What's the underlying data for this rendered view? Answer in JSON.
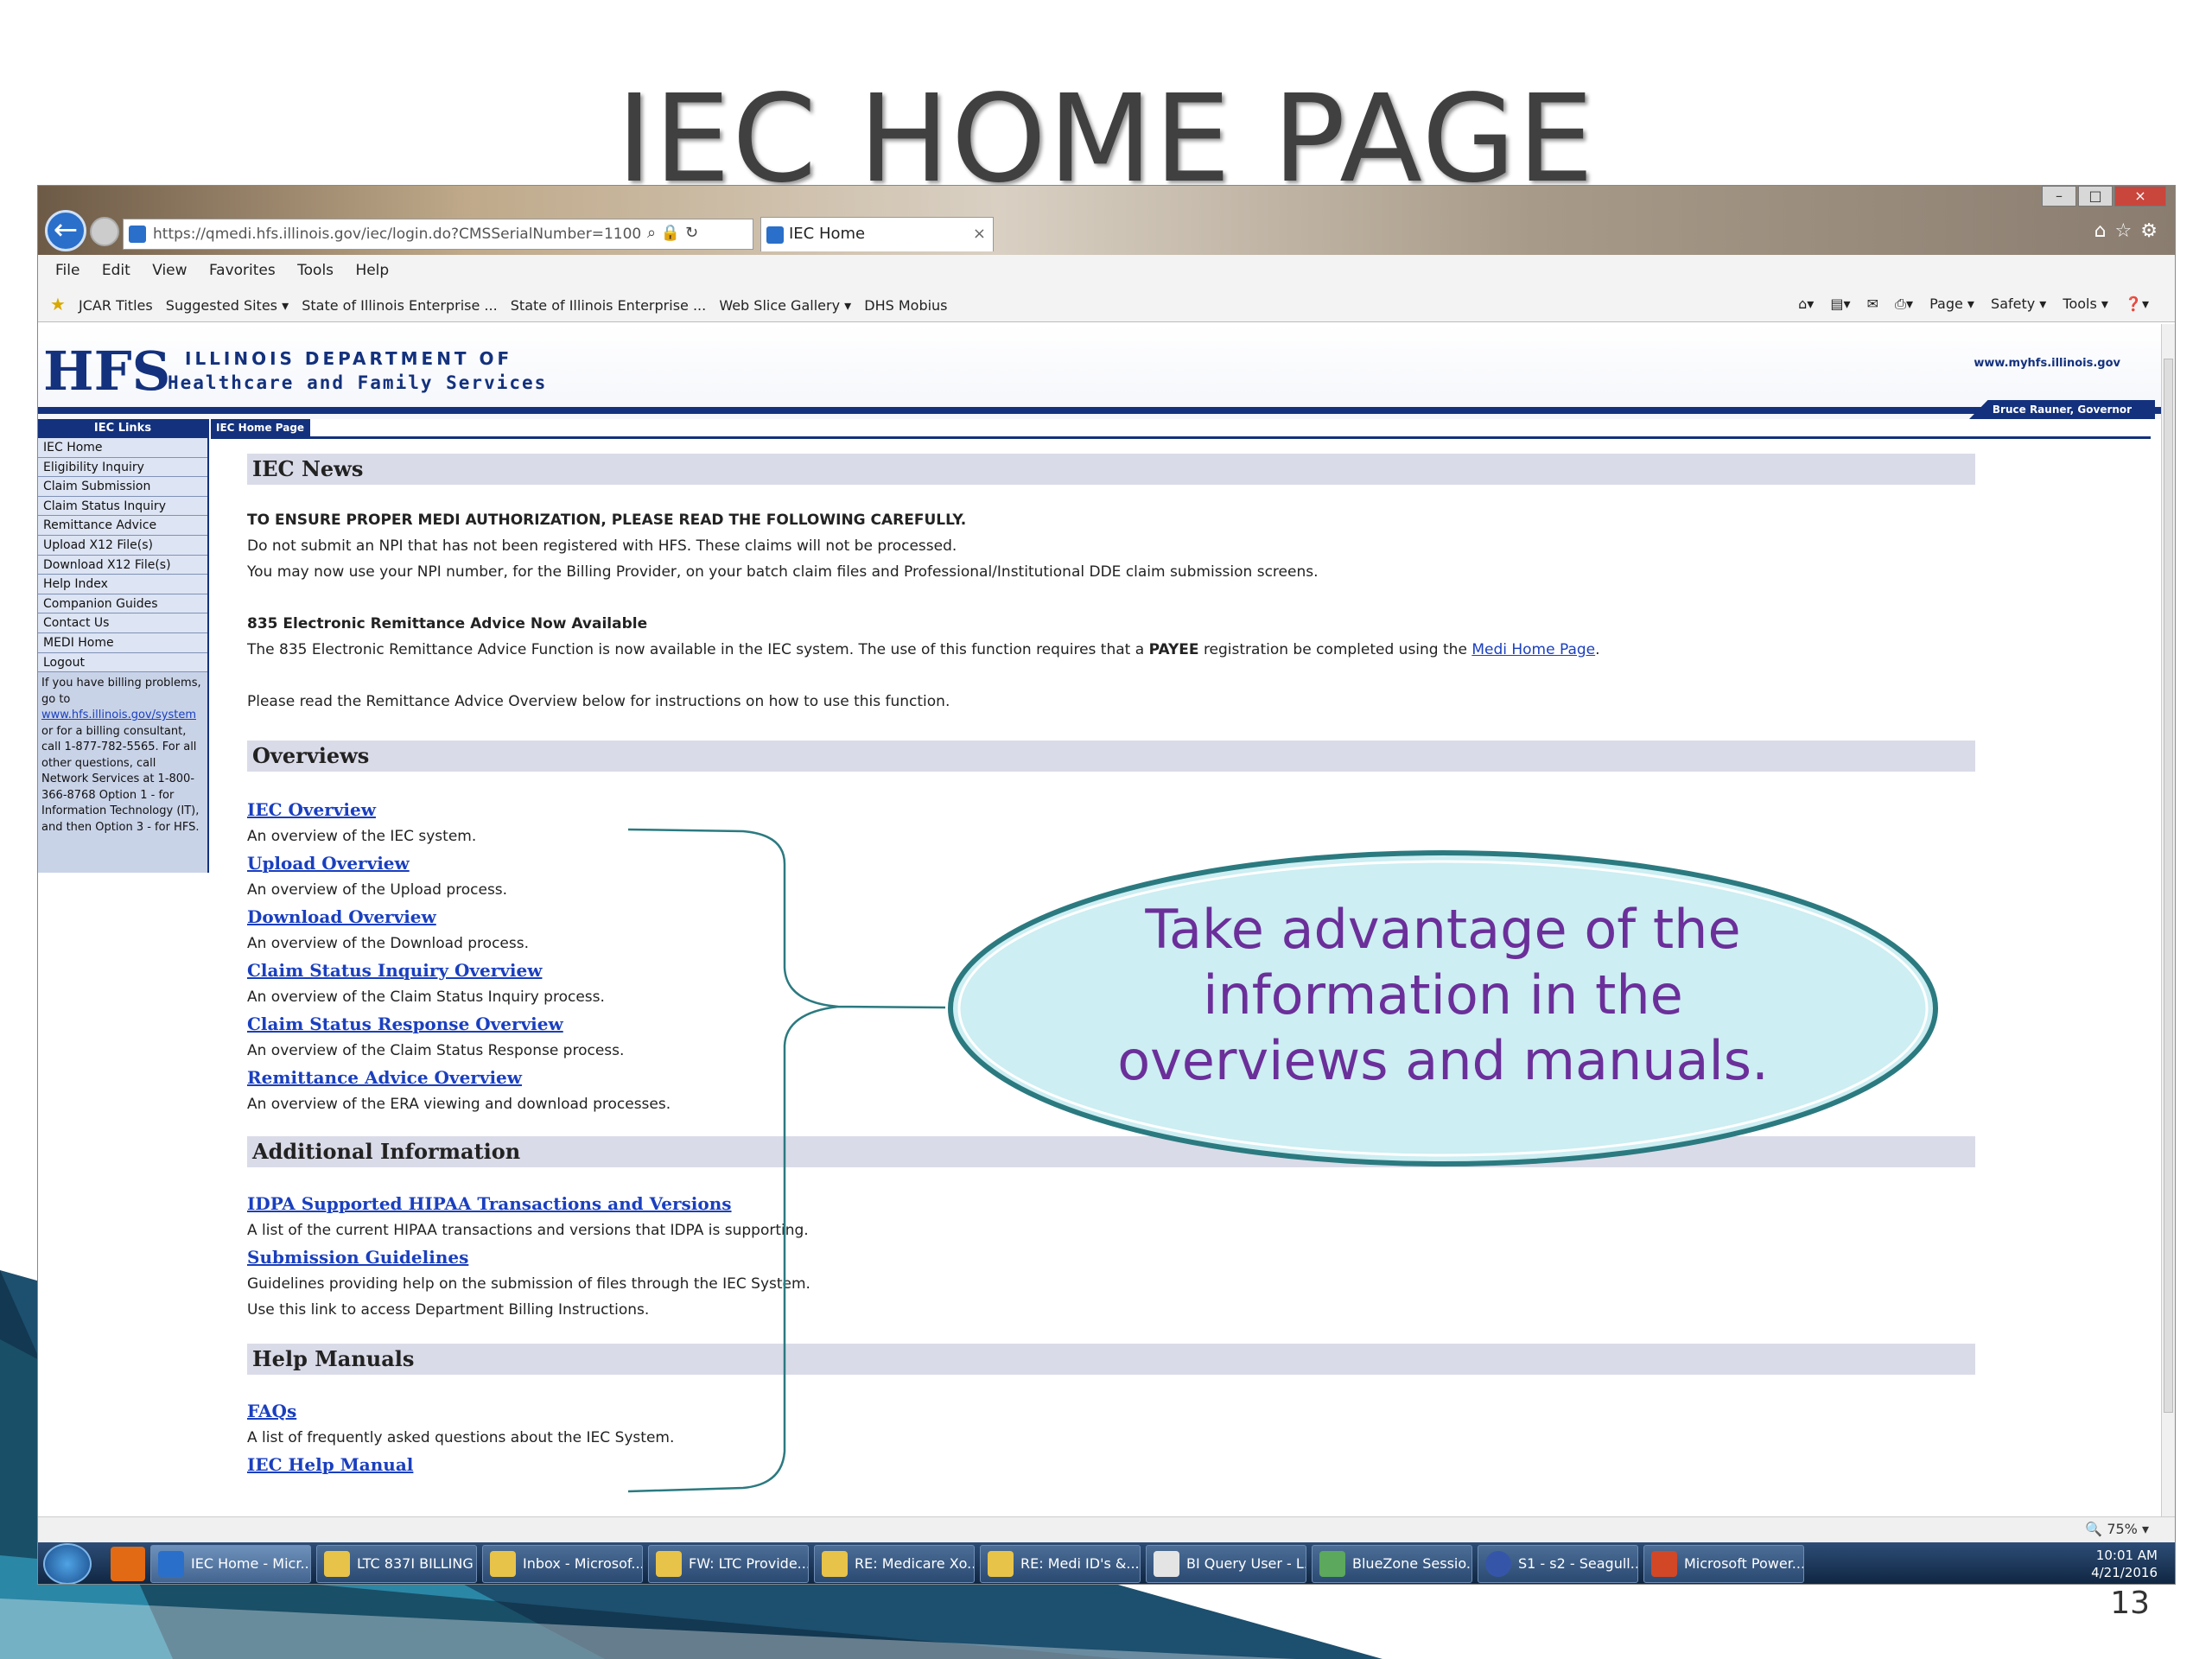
{
  "slide": {
    "title": "IEC HOME PAGE",
    "number": "13"
  },
  "browser": {
    "url": "https://qmedi.hfs.illinois.gov/iec/login.do?CMSSerialNumber=1100",
    "tab_title": "IEC Home",
    "menu": [
      "File",
      "Edit",
      "View",
      "Favorites",
      "Tools",
      "Help"
    ],
    "favorites": [
      "JCAR Titles",
      "Suggested Sites ▾",
      "State of Illinois Enterprise ...",
      "State of Illinois Enterprise ...",
      "Web Slice Gallery ▾",
      "DHS Mobius"
    ],
    "commands": [
      "Page ▾",
      "Safety ▾",
      "Tools ▾"
    ],
    "zoom": "75%"
  },
  "header": {
    "logo": "HFS",
    "dept_line1": "ILLINOIS DEPARTMENT OF",
    "dept_line2": "Healthcare and Family Services",
    "site_url": "www.myhfs.illinois.gov",
    "governor": "Bruce Rauner, Governor"
  },
  "sidebar": {
    "heading": "IEC Links",
    "items": [
      {
        "label": "IEC Home"
      },
      {
        "label": "Eligibility Inquiry"
      },
      {
        "label": "Claim Submission"
      },
      {
        "label": "Claim Status Inquiry"
      },
      {
        "label": "Remittance Advice"
      },
      {
        "label": "Upload X12 File(s)"
      },
      {
        "label": "Download X12 File(s)"
      },
      {
        "label": "Help Index"
      },
      {
        "label": "Companion Guides"
      },
      {
        "label": "Contact Us"
      },
      {
        "label": "MEDI Home"
      },
      {
        "label": "Logout"
      }
    ],
    "note_pre": "If you have billing problems, go to",
    "note_link": "www.hfs.illinois.gov/system",
    "note_post": "or for a billing consultant, call 1-877-782-5565. For all other questions, call Network Services at 1-800-366-8768 Option 1 - for Information Technology (IT), and then Option 3 - for HFS."
  },
  "page_tab": "IEC Home Page",
  "news": {
    "heading": "IEC News",
    "alert": "TO ENSURE PROPER MEDI AUTHORIZATION, PLEASE READ THE FOLLOWING CAREFULLY.",
    "line1": "Do not submit an NPI that has not been registered with HFS. These claims will not be processed.",
    "line2": "You may now use your NPI number, for the Billing Provider, on your batch claim files and Professional/Institutional DDE claim submission screens.",
    "era_title": "835 Electronic Remittance Advice Now Available",
    "era_text_pre": "The 835 Electronic Remittance Advice Function is now available in the IEC system. The use of this function requires that a",
    "era_bold": "PAYEE",
    "era_text_mid": "registration be completed using the",
    "era_link": "Medi Home Page",
    "era_text_end": ".",
    "read_note": "Please read the Remittance Advice Overview below for instructions on how to use this function."
  },
  "overviews": {
    "heading": "Overviews",
    "items": [
      {
        "link": "IEC Overview",
        "desc": "An overview of the IEC system."
      },
      {
        "link": "Upload Overview",
        "desc": "An overview of the Upload process."
      },
      {
        "link": "Download Overview",
        "desc": "An overview of the Download process."
      },
      {
        "link": "Claim Status Inquiry Overview",
        "desc": "An overview of the Claim Status Inquiry process."
      },
      {
        "link": "Claim Status Response Overview",
        "desc": "An overview of the Claim Status Response process."
      },
      {
        "link": "Remittance Advice Overview",
        "desc": "An overview of the ERA viewing and download processes."
      }
    ]
  },
  "additional": {
    "heading": "Additional Information",
    "item1_link": "IDPA Supported HIPAA Transactions and Versions",
    "item1_desc": "A list of the current HIPAA transactions and versions that IDPA is supporting.",
    "item2_link": "Submission Guidelines",
    "item2_desc": "Guidelines providing help on the submission of files through the IEC System.",
    "item2_desc2": "Use this link to access Department Billing Instructions."
  },
  "manuals": {
    "heading": "Help Manuals",
    "item1_link": "FAQs",
    "item1_desc": "A list of frequently asked questions about the IEC System.",
    "item2_link": "IEC Help Manual"
  },
  "callout": {
    "line1": "Take advantage of the",
    "line2": "information in the",
    "line3": "overviews and manuals.",
    "fill": "#cdeef2",
    "stroke": "#2b7a80",
    "text_color": "#6b2f9a"
  },
  "taskbar": {
    "items": [
      {
        "label": "IEC Home - Micr..."
      },
      {
        "label": "LTC 837I BILLING"
      },
      {
        "label": "Inbox - Microsof..."
      },
      {
        "label": "FW: LTC Provide..."
      },
      {
        "label": "RE: Medicare Xo..."
      },
      {
        "label": "RE: Medi ID's &..."
      },
      {
        "label": "BI Query User - L..."
      },
      {
        "label": "BlueZone Sessio..."
      },
      {
        "label": "S1 - s2 - Seagull..."
      },
      {
        "label": "Microsoft Power..."
      }
    ],
    "time": "10:01 AM",
    "date": "4/21/2016"
  }
}
